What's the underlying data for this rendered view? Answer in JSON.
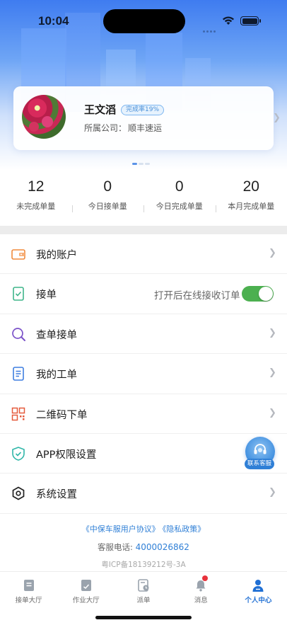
{
  "status_bar": {
    "time": "10:04"
  },
  "profile": {
    "name": "王文滔",
    "completion_badge": "完成率19%",
    "company_label": "所属公司：",
    "company_name": "顺丰速运"
  },
  "stats": [
    {
      "value": "12",
      "label": "未完成单量"
    },
    {
      "value": "0",
      "label": "今日接单量"
    },
    {
      "value": "0",
      "label": "今日完成单量"
    },
    {
      "value": "20",
      "label": "本月完成单量"
    }
  ],
  "menu": [
    {
      "label": "我的账户",
      "icon": "wallet-icon"
    },
    {
      "label": "接单",
      "icon": "order-receive-icon",
      "hint": "打开后在线接收订单",
      "toggle_on": true
    },
    {
      "label": "查单接单",
      "icon": "search-icon"
    },
    {
      "label": "我的工单",
      "icon": "document-icon"
    },
    {
      "label": "二维码下单",
      "icon": "qrcode-icon"
    },
    {
      "label": "APP权限设置",
      "icon": "shield-icon"
    },
    {
      "label": "系统设置",
      "icon": "settings-hex-icon"
    }
  ],
  "contact": {
    "label": "联系客服",
    "icon": "headset-icon"
  },
  "footer": {
    "agreement": "《中保车服用户协议》",
    "privacy": "《隐私政策》",
    "phone_label": "客服电话:",
    "phone_number": "4000026862",
    "icp": "粤ICP备18139212号-3A"
  },
  "tabs": [
    {
      "label": "接单大厅",
      "icon": "hall-icon"
    },
    {
      "label": "作业大厅",
      "icon": "work-icon"
    },
    {
      "label": "派单",
      "icon": "dispatch-icon"
    },
    {
      "label": "消息",
      "icon": "bell-icon",
      "badge": true
    },
    {
      "label": "个人中心",
      "icon": "person-icon",
      "active": true
    }
  ],
  "colors": {
    "accent": "#2f7fd6",
    "header_gradient_top": "#3f7cf0",
    "toggle_on": "#4cb050",
    "badge_red": "#e8323c"
  }
}
